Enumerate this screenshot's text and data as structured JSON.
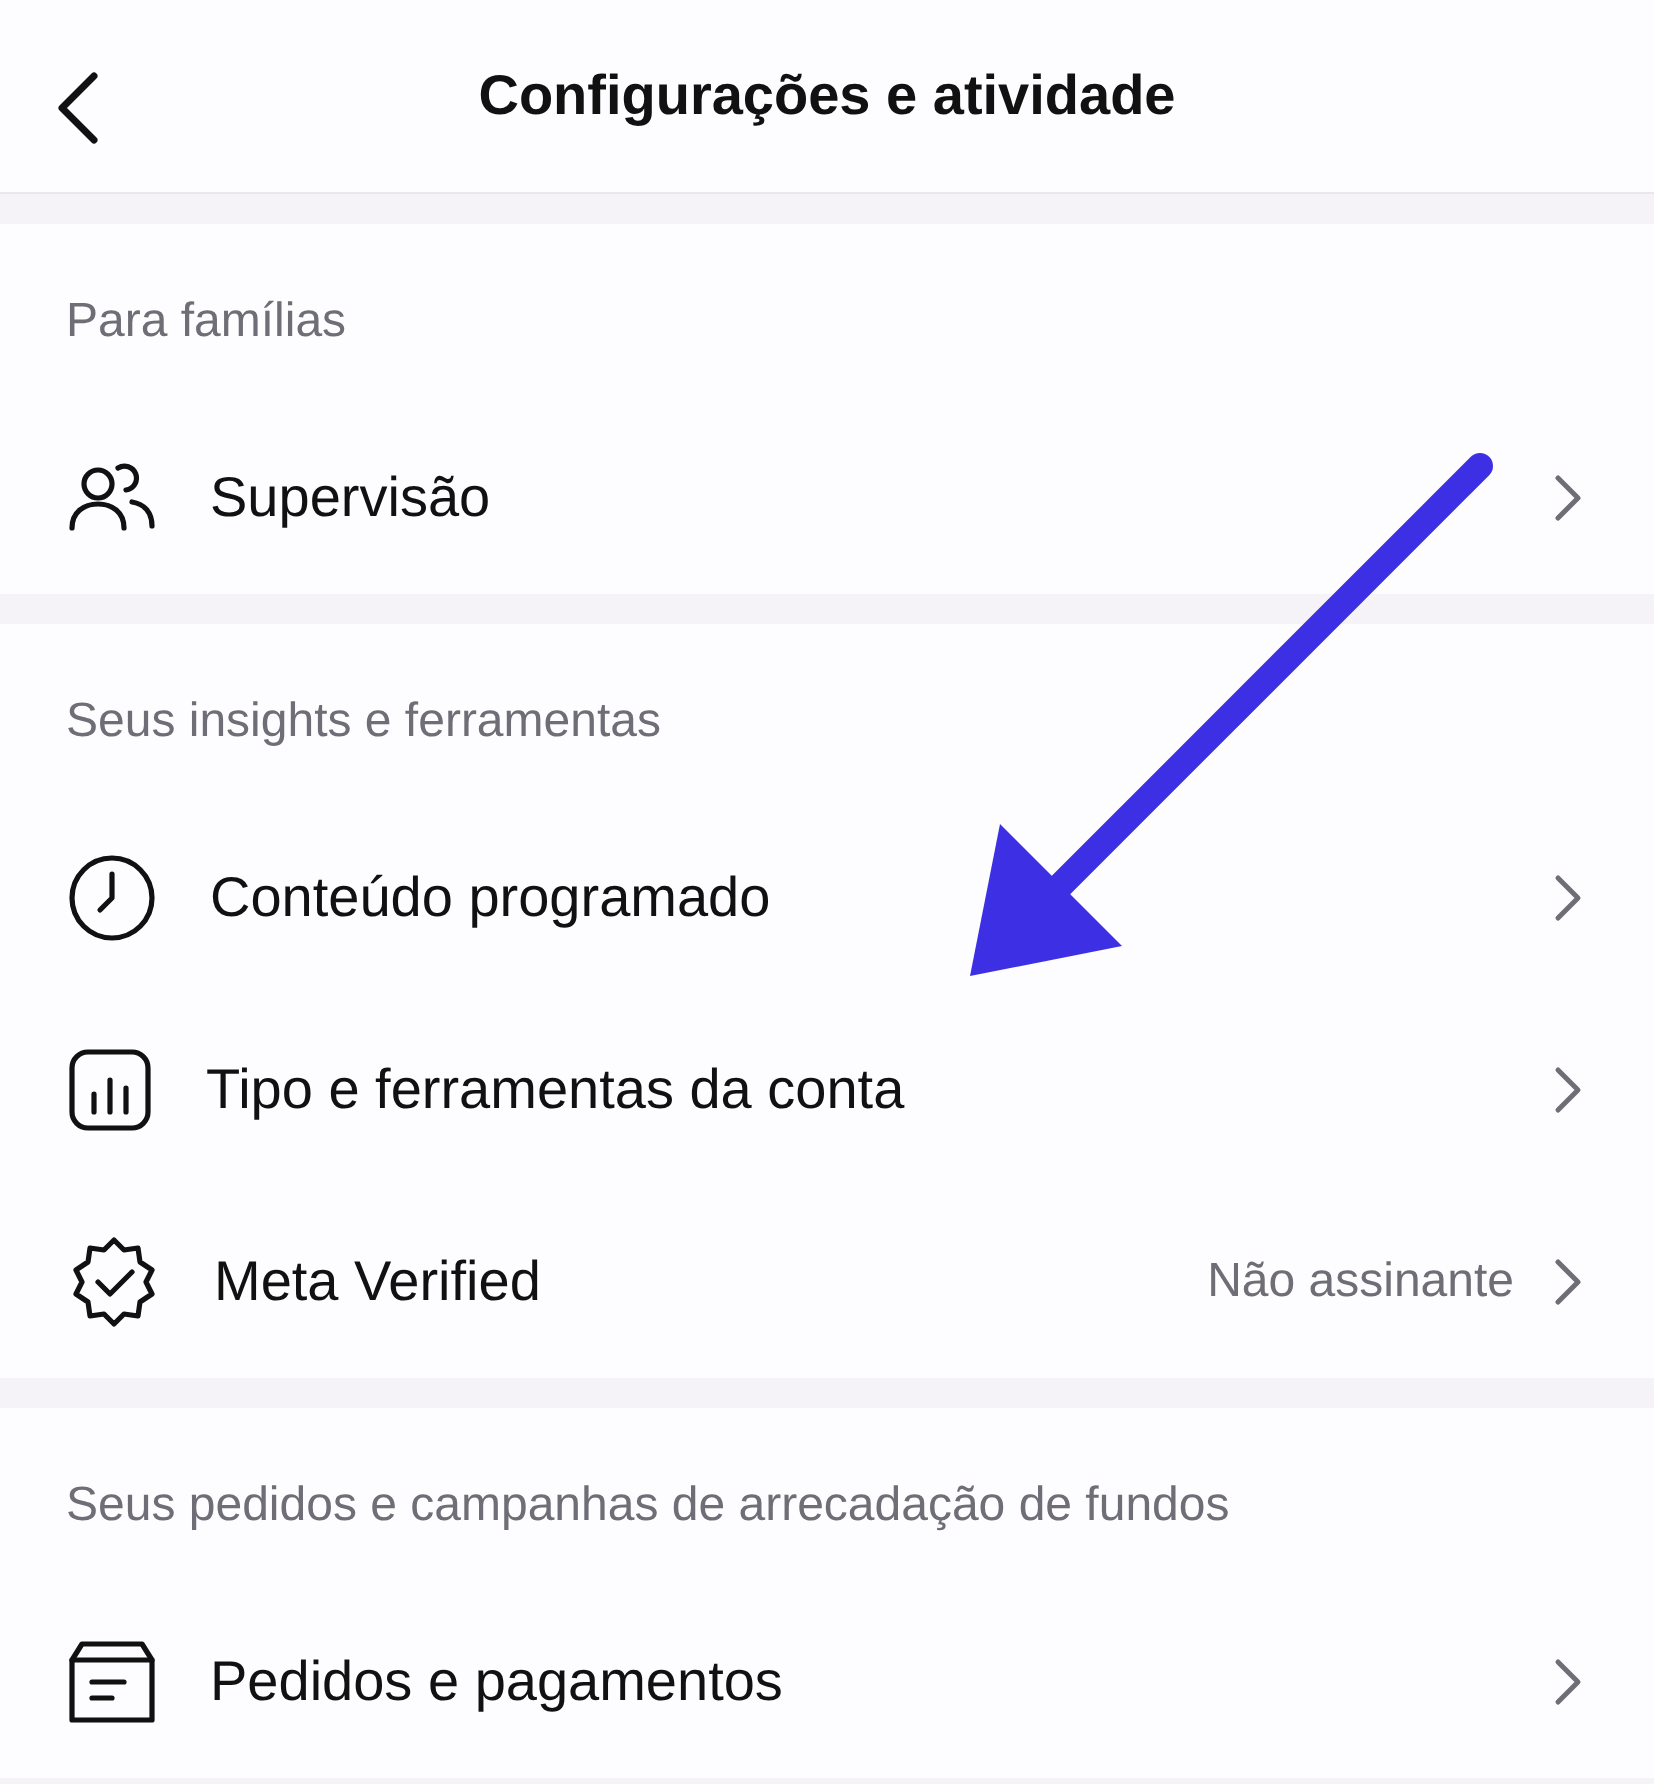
{
  "header": {
    "title": "Configurações e atividade"
  },
  "sections": [
    {
      "heading": "Para famílias",
      "items": [
        {
          "label": "Supervisão"
        }
      ]
    },
    {
      "heading": "Seus insights e ferramentas",
      "items": [
        {
          "label": "Conteúdo programado"
        },
        {
          "label": "Tipo e ferramentas da conta"
        },
        {
          "label": "Meta Verified",
          "value": "Não assinante"
        }
      ]
    },
    {
      "heading": "Seus pedidos e campanhas de arrecadação de fundos",
      "items": [
        {
          "label": "Pedidos e pagamentos"
        }
      ]
    }
  ]
}
